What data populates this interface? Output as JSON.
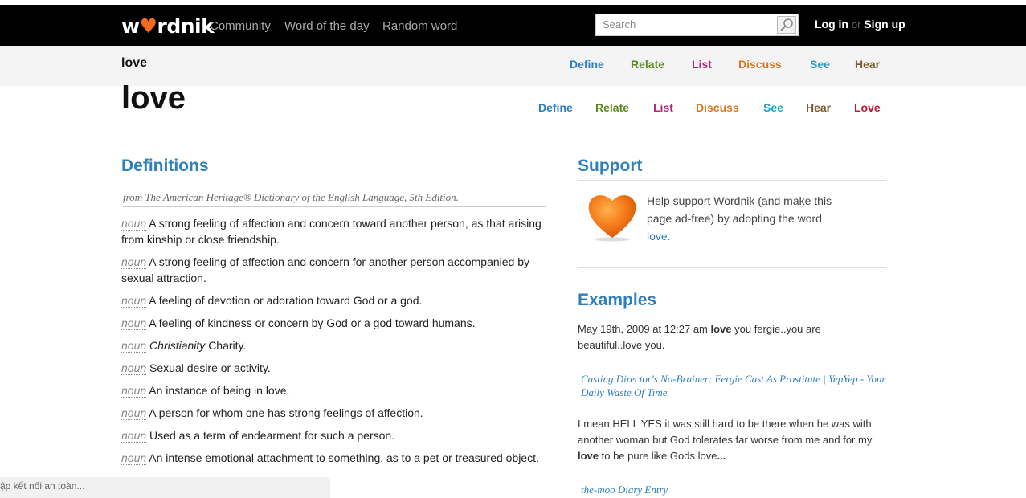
{
  "header": {
    "logo_pre": "w",
    "logo_heart": "♥",
    "logo_post": "rdnik",
    "nav": [
      "Community",
      "Word of the day",
      "Random word"
    ],
    "search_placeholder": "Search",
    "login": "Log in",
    "or": "or",
    "signup": "Sign up"
  },
  "subbar": {
    "word": "love",
    "links": [
      {
        "label": "Define",
        "color": "#2d7fbd"
      },
      {
        "label": "Relate",
        "color": "#5a8a1e"
      },
      {
        "label": "List",
        "color": "#b0287a"
      },
      {
        "label": "Discuss",
        "color": "#d9761c"
      },
      {
        "label": "See",
        "color": "#2a9fc0"
      },
      {
        "label": "Hear",
        "color": "#7a5a2a"
      }
    ]
  },
  "main": {
    "word": "love",
    "links": [
      {
        "label": "Define",
        "color": "#2d7fbd"
      },
      {
        "label": "Relate",
        "color": "#5a8a1e"
      },
      {
        "label": "List",
        "color": "#b0287a"
      },
      {
        "label": "Discuss",
        "color": "#d9761c"
      },
      {
        "label": "See",
        "color": "#2a9fc0"
      },
      {
        "label": "Hear",
        "color": "#7a5a2a"
      },
      {
        "label": "Love",
        "color": "#c0183c"
      }
    ]
  },
  "definitions": {
    "heading": "Definitions",
    "source": "from The American Heritage® Dictionary of the English Language, 5th Edition.",
    "items": [
      {
        "pos": "noun",
        "label": "",
        "text": "A strong feeling of affection and concern toward another person, as that arising from kinship or close friendship."
      },
      {
        "pos": "noun",
        "label": "",
        "text": "A strong feeling of affection and concern for another person accompanied by sexual attraction."
      },
      {
        "pos": "noun",
        "label": "",
        "text": "A feeling of devotion or adoration toward God or a god."
      },
      {
        "pos": "noun",
        "label": "",
        "text": "A feeling of kindness or concern by God or a god toward humans."
      },
      {
        "pos": "noun",
        "label": "Christianity",
        "text": "Charity."
      },
      {
        "pos": "noun",
        "label": "",
        "text": "Sexual desire or activity."
      },
      {
        "pos": "noun",
        "label": "",
        "text": "An instance of being in love."
      },
      {
        "pos": "noun",
        "label": "",
        "text": "A person for whom one has strong feelings of affection."
      },
      {
        "pos": "noun",
        "label": "",
        "text": "Used as a term of endearment for such a person."
      },
      {
        "pos": "noun",
        "label": "",
        "text": "An intense emotional attachment to something, as to a pet or treasured object."
      }
    ]
  },
  "support": {
    "heading": "Support",
    "text": "Help support Wordnik (and make this page ad-free) by adopting the word",
    "word": "love."
  },
  "examples": {
    "heading": "Examples",
    "ex1_pre": "May 19th, 2009 at 12:27 am ",
    "ex1_bold": "love",
    "ex1_post": " you fergie..you are beautiful..love you.",
    "src1": "Casting Director's No-Brainer: Fergie Cast As Prostitute | YepYep - Your Daily Waste Of Time",
    "ex2_pre": "I mean HELL YES it was still hard to be there when he was with another woman but God tolerates far worse from me and for my ",
    "ex2_bold": "love",
    "ex2_post": " to be pure like Gods love",
    "ex2_ellipsis": "...",
    "src2": "the-moo Diary Entry"
  },
  "status": "ập kết nối an toàn..."
}
